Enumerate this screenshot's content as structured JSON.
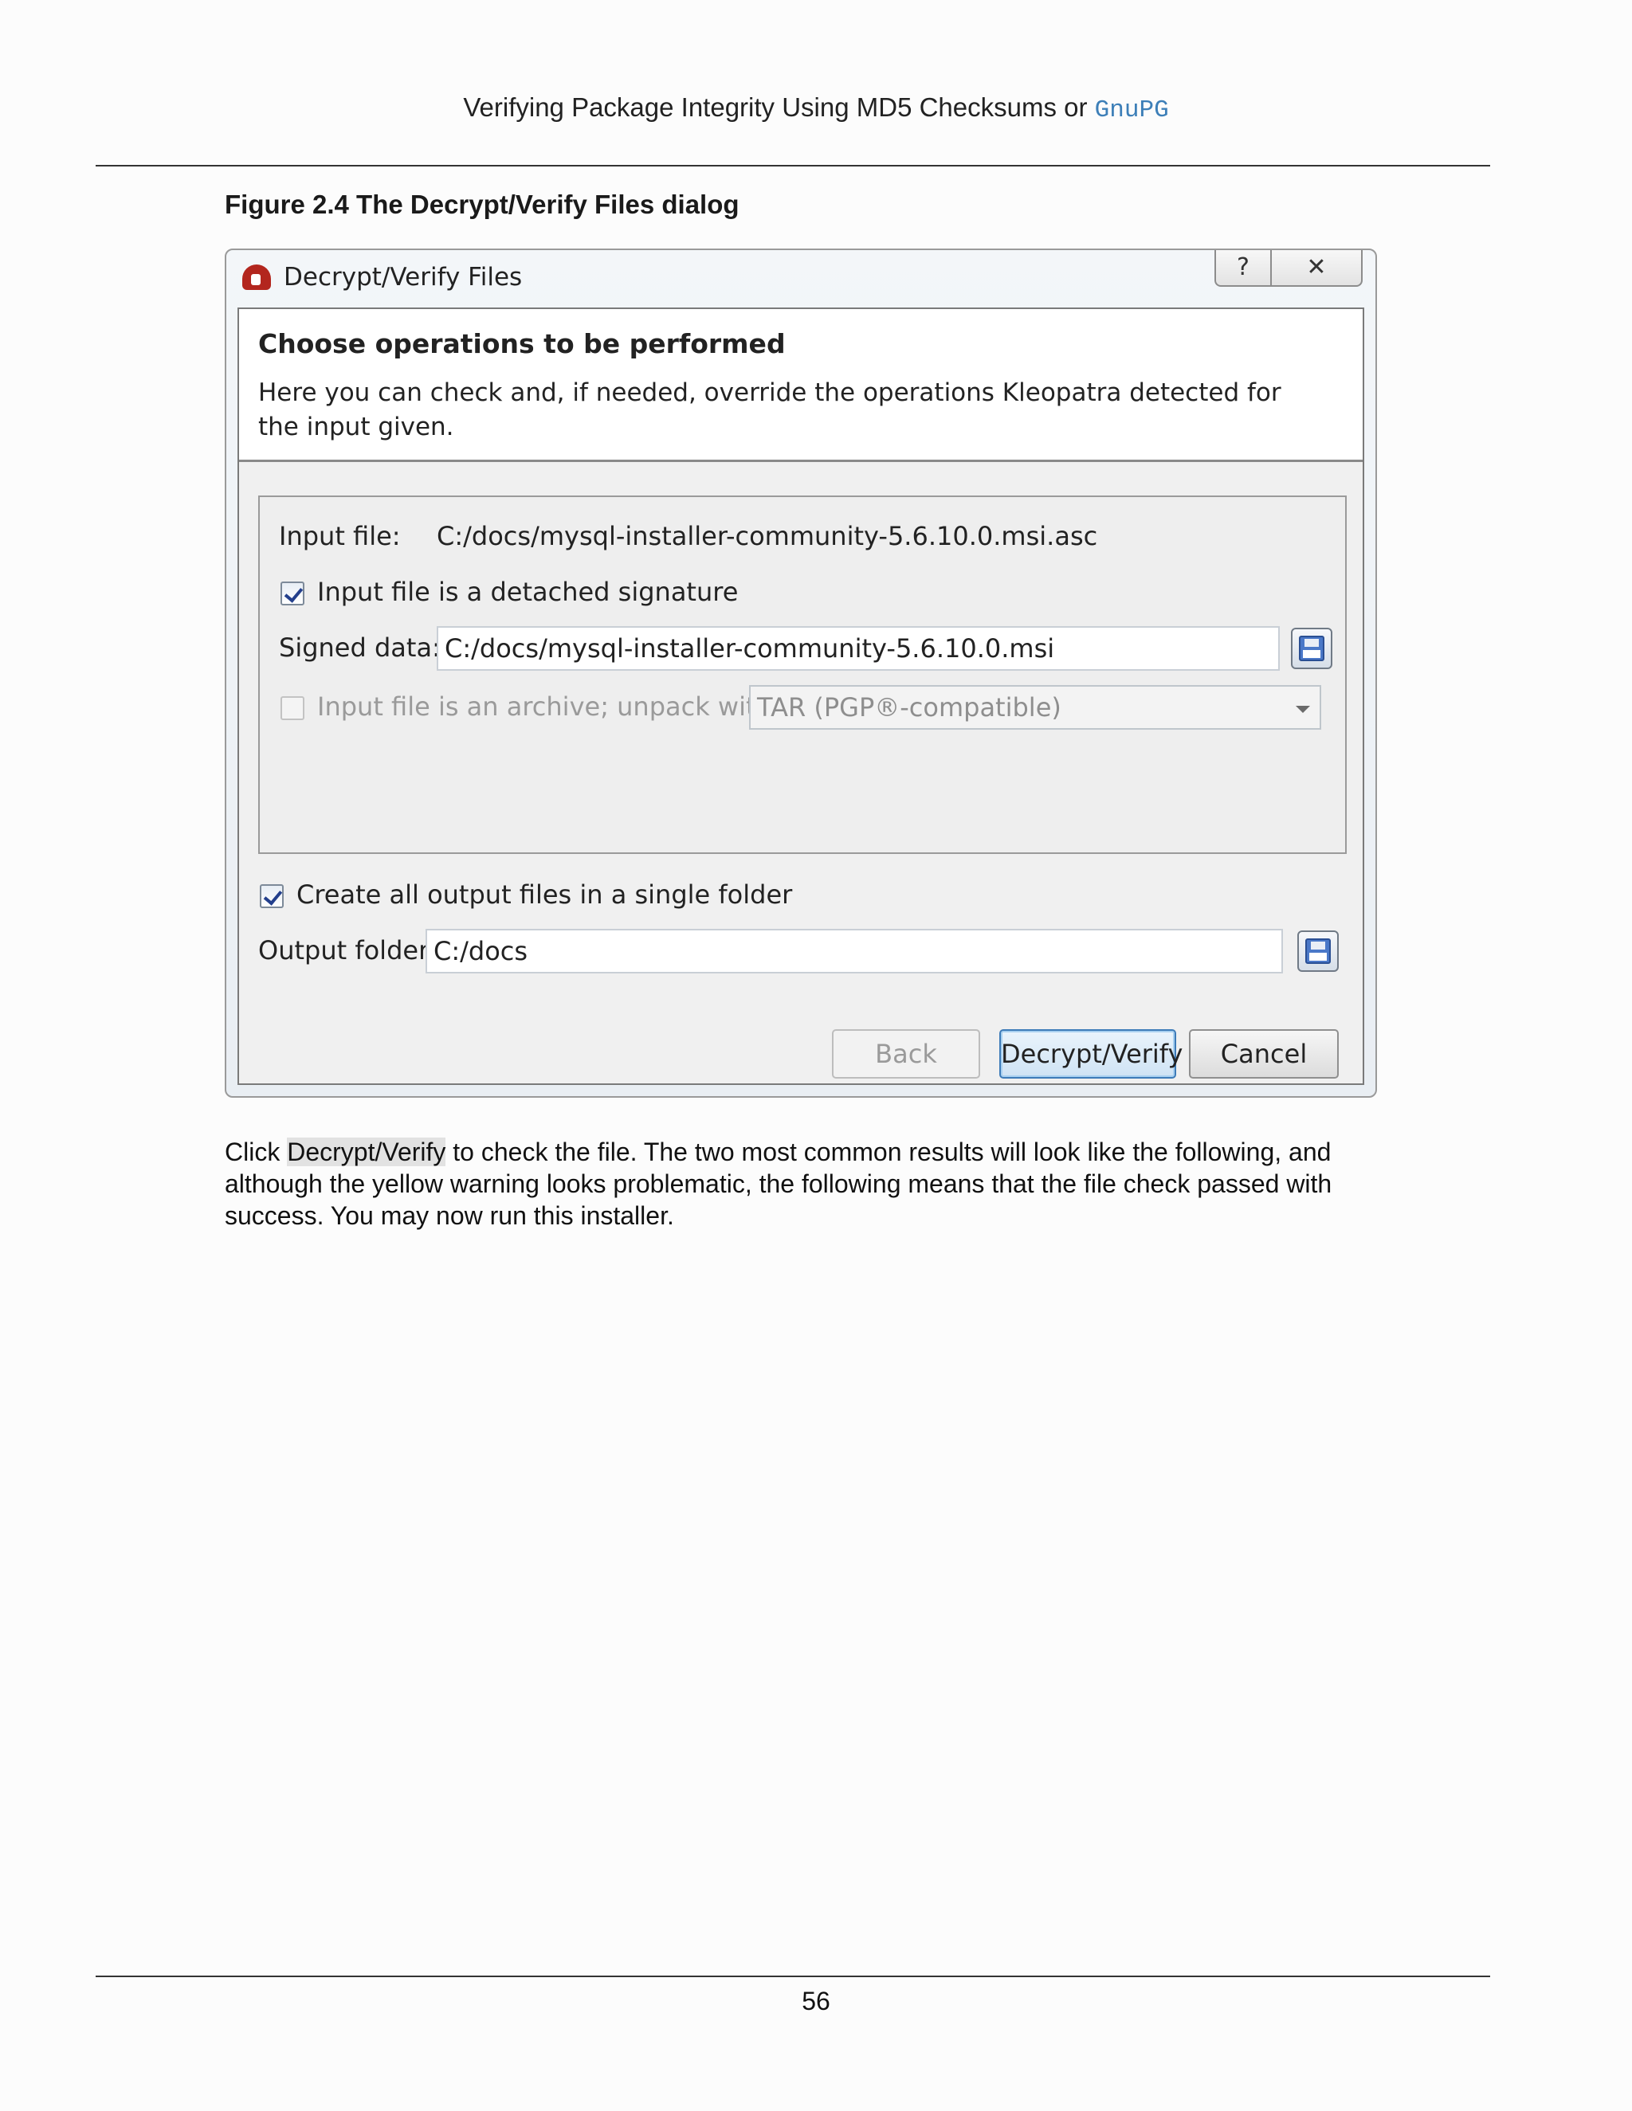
{
  "header": {
    "title_prefix": "Verifying Package Integrity Using MD5 Checksums or",
    "title_code": "GnuPG"
  },
  "figure": {
    "caption": "Figure 2.4 The Decrypt/Verify Files dialog"
  },
  "dialog": {
    "app_icon": "kleopatra-icon",
    "title": "Decrypt/Verify Files",
    "help_symbol": "?",
    "close_symbol": "✕",
    "banner_title": "Choose operations to be performed",
    "banner_description": "Here you can check and, if needed, override the operations Kleopatra detected for the input given.",
    "input_file_label": "Input file:",
    "input_file_value": "C:/docs/mysql-installer-community-5.6.10.0.msi.asc",
    "detached_signature_label": "Input file is a detached signature",
    "detached_signature_checked": true,
    "signed_data_label": "Signed data:",
    "signed_data_value": "C:/docs/mysql-installer-community-5.6.10.0.msi",
    "archive_label": "Input file is an archive; unpack with:",
    "archive_checked": false,
    "archive_format_selected": "TAR (PGP®-compatible)",
    "single_folder_label": "Create all output files in a single folder",
    "single_folder_checked": true,
    "output_folder_label": "Output folder:",
    "output_folder_value": "C:/docs",
    "save_icon": "save-disk-icon",
    "buttons": {
      "back": "Back",
      "decrypt_verify": "Decrypt/Verify",
      "cancel": "Cancel"
    }
  },
  "body": {
    "click": "Click",
    "ui_reference": "Decrypt/Verify",
    "text": "to check the file. The two most common results will look like the following, and although the yellow warning looks problematic, the following means that the file check passed with success. You may now run this installer."
  },
  "footer": {
    "page_number": "56"
  }
}
